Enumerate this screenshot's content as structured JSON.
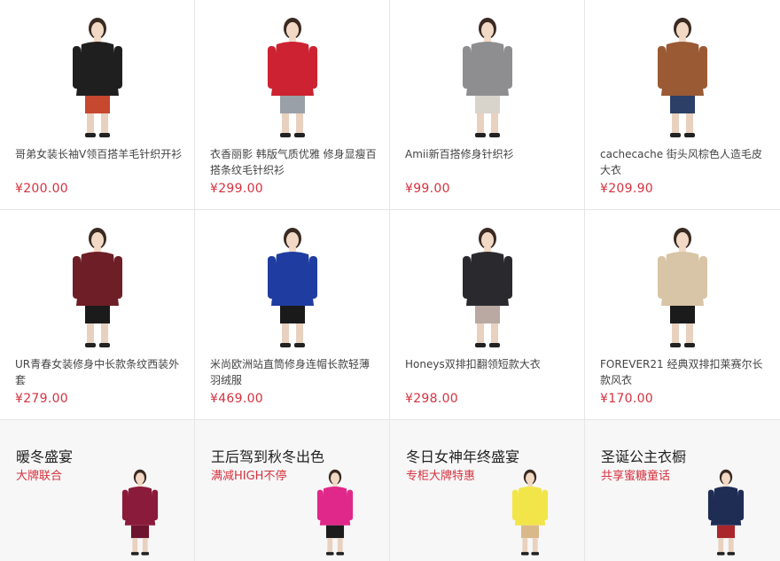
{
  "products": [
    {
      "title": "哥弟女装长袖V领百搭羊毛针织开衫",
      "price": "¥200.00",
      "icon": "black-cardigan-model",
      "colors": [
        "#1f1f1f",
        "#c6482e"
      ]
    },
    {
      "title": "衣香丽影 韩版气质优雅 修身显瘦百搭条纹毛针织衫",
      "price": "¥299.00",
      "icon": "striped-sweater-model",
      "colors": [
        "#cc2231",
        "#9aa0a8"
      ]
    },
    {
      "title": "Amii新百搭修身针织衫",
      "price": "¥99.00",
      "icon": "grey-knit-model",
      "colors": [
        "#8e8e90",
        "#d8d3cb"
      ]
    },
    {
      "title": "cachecache 街头风棕色人造毛皮大衣",
      "price": "¥209.90",
      "icon": "brown-fur-coat-model",
      "colors": [
        "#9a5a33",
        "#2c3f66"
      ]
    },
    {
      "title": "UR青春女装修身中长款条纹西装外套",
      "price": "¥279.00",
      "icon": "burgundy-long-coat-model",
      "colors": [
        "#6e1e26",
        "#1b1b1b"
      ]
    },
    {
      "title": "米尚欧洲站直筒修身连帽长款轻薄羽绒服",
      "price": "¥469.00",
      "icon": "blue-down-coat-model",
      "colors": [
        "#1f3ca0",
        "#1a1a1a"
      ]
    },
    {
      "title": "Honeys双排扣翻领短款大衣",
      "price": "¥298.00",
      "icon": "black-pea-coat-model",
      "colors": [
        "#2a2a2e",
        "#b9a9a2"
      ]
    },
    {
      "title": "FOREVER21 经典双排扣莱赛尔长款风衣",
      "price": "¥170.00",
      "icon": "beige-trench-model",
      "colors": [
        "#d8c4a6",
        "#1b1b1b"
      ]
    }
  ],
  "promos": [
    {
      "title": "暖冬盛宴",
      "subtitle": "大牌联合",
      "icon": "burgundy-coat-image",
      "colors": [
        "#8a1b3a",
        "#6d1430"
      ]
    },
    {
      "title": "王后驾到秋冬出色",
      "subtitle": "满减HIGH不停",
      "icon": "pink-coat-model",
      "colors": [
        "#e0288a",
        "#1c1c1c"
      ]
    },
    {
      "title": "冬日女神年终盛宴",
      "subtitle": "专柜大牌特惠",
      "icon": "yellow-coat-model",
      "colors": [
        "#f2e54a",
        "#d9b98a"
      ]
    },
    {
      "title": "圣诞公主衣橱",
      "subtitle": "共享蜜糖童话",
      "icon": "plaid-coat-model",
      "colors": [
        "#1f2d55",
        "#a8262c"
      ]
    }
  ]
}
